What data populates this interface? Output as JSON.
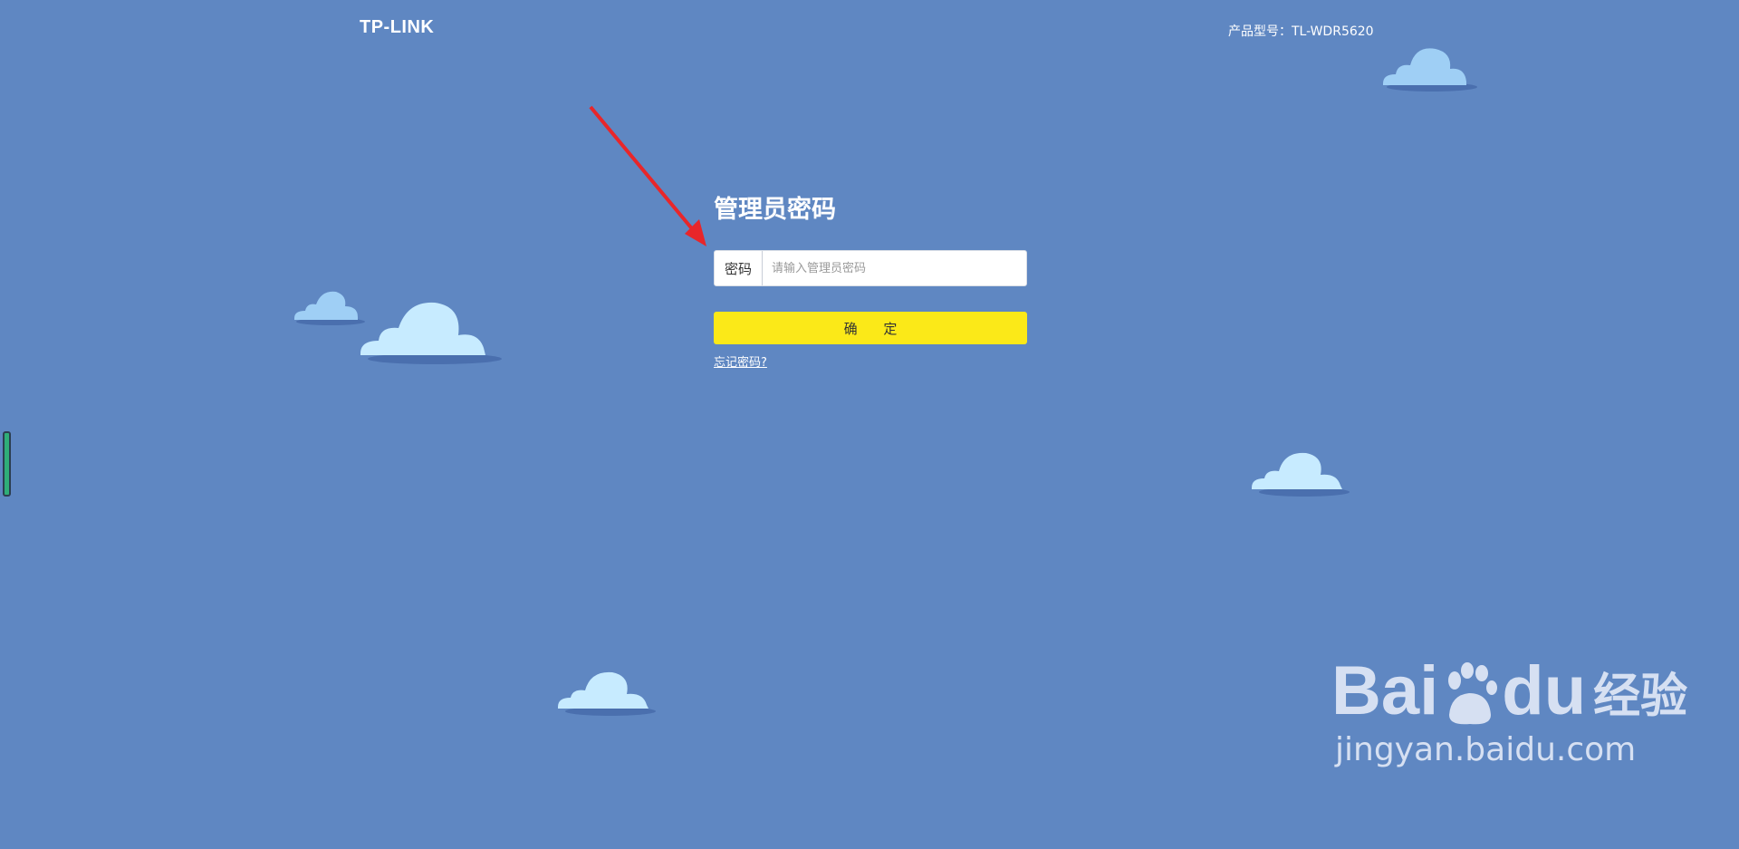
{
  "header": {
    "logo_text": "TP-LINK",
    "model_text": "产品型号：TL-WDR5620"
  },
  "login": {
    "title": "管理员密码",
    "password_label": "密码",
    "password_placeholder": "请输入管理员密码",
    "password_value": "",
    "confirm_label": "确 定",
    "forgot_link": "忘记密码?"
  },
  "watermark": {
    "brand_left": "Bai",
    "brand_right": "du",
    "brand_cn": "经验",
    "url": "jingyan.baidu.com"
  },
  "colors": {
    "background": "#5f87c2",
    "button": "#fbe918",
    "cloud_light": "#c7ebff",
    "cloud_shadow": "#4a6fae",
    "arrow": "#e8262a"
  },
  "icons": {
    "arrow": "red-arrow-icon",
    "cloud": "cloud-icon",
    "paw": "baidu-paw-icon"
  }
}
